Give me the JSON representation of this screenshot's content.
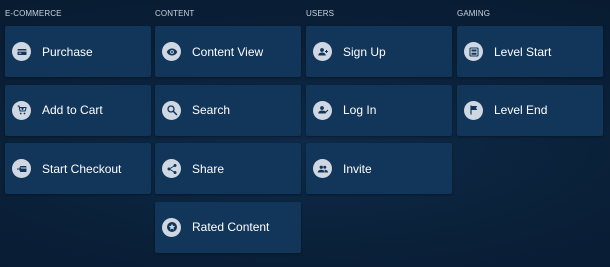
{
  "categories": [
    {
      "title": "E-COMMERCE",
      "events": [
        {
          "label": "Purchase",
          "icon": "credit-card-icon"
        },
        {
          "label": "Add to Cart",
          "icon": "shopping-cart-icon"
        },
        {
          "label": "Start Checkout",
          "icon": "checkout-icon"
        }
      ]
    },
    {
      "title": "CONTENT",
      "events": [
        {
          "label": "Content View",
          "icon": "eye-icon"
        },
        {
          "label": "Search",
          "icon": "search-icon"
        },
        {
          "label": "Share",
          "icon": "share-icon"
        },
        {
          "label": "Rated Content",
          "icon": "star-icon"
        }
      ]
    },
    {
      "title": "USERS",
      "events": [
        {
          "label": "Sign Up",
          "icon": "person-add-icon"
        },
        {
          "label": "Log In",
          "icon": "person-login-icon"
        },
        {
          "label": "Invite",
          "icon": "group-add-icon"
        }
      ]
    },
    {
      "title": "GAMING",
      "events": [
        {
          "label": "Level Start",
          "icon": "level-start-icon"
        },
        {
          "label": "Level End",
          "icon": "flag-icon"
        }
      ]
    }
  ],
  "colors": {
    "tile": "#12355a",
    "icon_bg": "#cfd8e2",
    "icon_fg": "#12355a",
    "text": "#ffffff",
    "header_text": "#c7d3e0"
  }
}
